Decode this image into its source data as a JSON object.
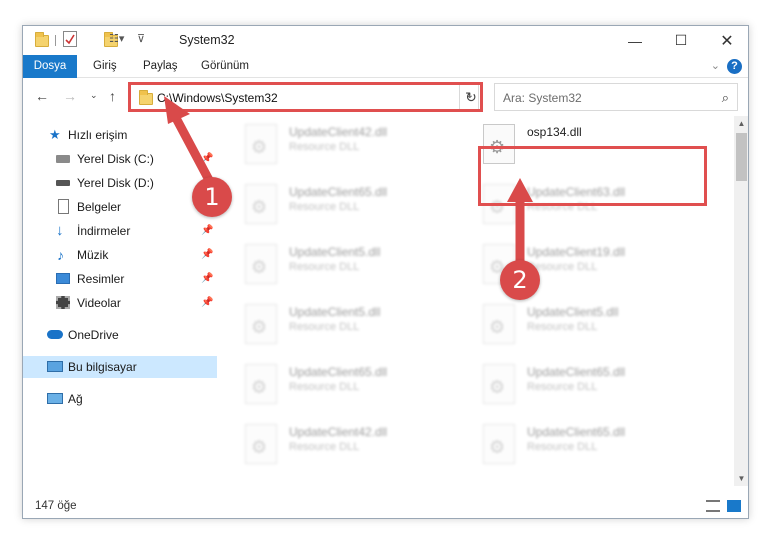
{
  "window": {
    "title": "System32"
  },
  "ribbon": {
    "tabs": [
      "Dosya",
      "Giriş",
      "Paylaş",
      "Görünüm"
    ]
  },
  "address": {
    "path": "C:\\Windows\\System32"
  },
  "search": {
    "placeholder": "Ara: System32"
  },
  "nav_pane": {
    "quick_access": "Hızlı erişim",
    "items": [
      {
        "label": "Yerel Disk (C:)",
        "icon": "drive-icon",
        "pinned": true
      },
      {
        "label": "Yerel Disk (D:)",
        "icon": "drive-icon",
        "pinned": false
      },
      {
        "label": "Belgeler",
        "icon": "documents-icon",
        "pinned": true
      },
      {
        "label": "İndirmeler",
        "icon": "download-icon",
        "pinned": true
      },
      {
        "label": "Müzik",
        "icon": "music-icon",
        "pinned": true
      },
      {
        "label": "Resimler",
        "icon": "pictures-icon",
        "pinned": true
      },
      {
        "label": "Videolar",
        "icon": "video-icon",
        "pinned": true
      }
    ],
    "onedrive": "OneDrive",
    "this_pc": "Bu bilgisayar",
    "network": "Ağ"
  },
  "files": [
    {
      "name": "UpdateClient42.dll",
      "type": "Resource DLL",
      "blurred": true
    },
    {
      "name": "osp134.dll",
      "type": "",
      "blurred": false
    },
    {
      "name": "UpdateClient65.dll",
      "type": "Resource DLL",
      "blurred": true
    },
    {
      "name": "UpdateClient63.dll",
      "type": "Resource DLL",
      "blurred": true
    },
    {
      "name": "UpdateClient5.dll",
      "type": "Resource DLL",
      "blurred": true
    },
    {
      "name": "UpdateClient19.dll",
      "type": "Resource DLL",
      "blurred": true
    },
    {
      "name": "UpdateClient5.dll",
      "type": "Resource DLL",
      "blurred": true
    },
    {
      "name": "UpdateClient5.dll",
      "type": "Resource DLL",
      "blurred": true
    },
    {
      "name": "UpdateClient65.dll",
      "type": "Resource DLL",
      "blurred": true
    },
    {
      "name": "UpdateClient65.dll",
      "type": "Resource DLL",
      "blurred": true
    },
    {
      "name": "UpdateClient42.dll",
      "type": "Resource DLL",
      "blurred": true
    },
    {
      "name": "UpdateClient65.dll",
      "type": "Resource DLL",
      "blurred": true
    }
  ],
  "status": {
    "count": "147 öğe"
  },
  "annotations": {
    "step1": "1",
    "step2": "2",
    "color": "#d94a4a"
  },
  "colors": {
    "accent": "#1979ca",
    "selection": "#cce8ff"
  }
}
